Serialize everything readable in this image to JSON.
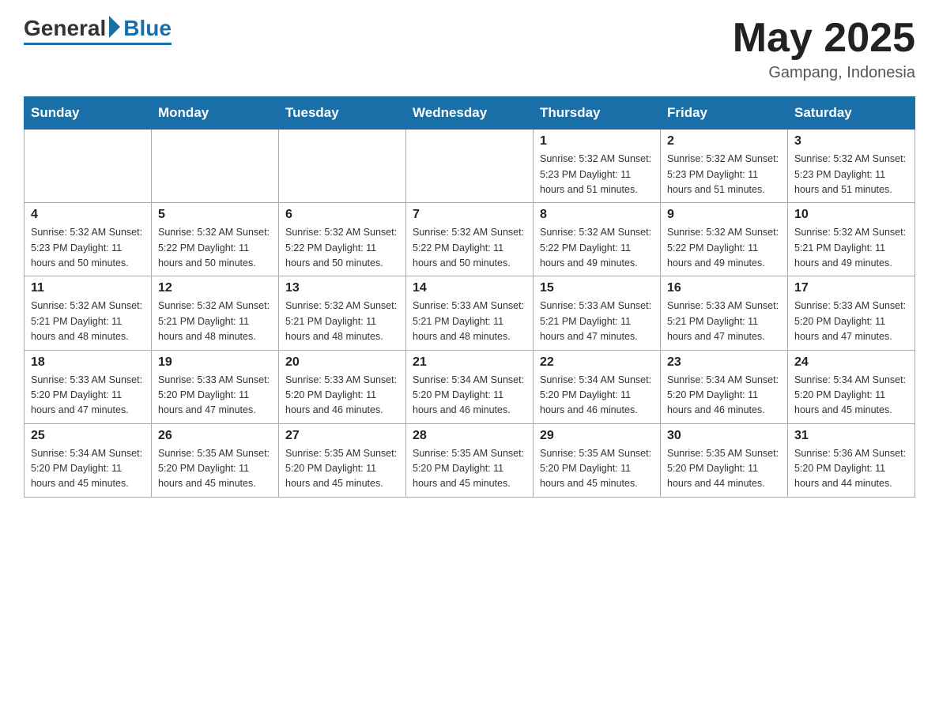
{
  "header": {
    "logo_general": "General",
    "logo_blue": "Blue",
    "month_title": "May 2025",
    "location": "Gampang, Indonesia"
  },
  "days_of_week": [
    "Sunday",
    "Monday",
    "Tuesday",
    "Wednesday",
    "Thursday",
    "Friday",
    "Saturday"
  ],
  "weeks": [
    [
      {
        "day": "",
        "info": ""
      },
      {
        "day": "",
        "info": ""
      },
      {
        "day": "",
        "info": ""
      },
      {
        "day": "",
        "info": ""
      },
      {
        "day": "1",
        "info": "Sunrise: 5:32 AM\nSunset: 5:23 PM\nDaylight: 11 hours\nand 51 minutes."
      },
      {
        "day": "2",
        "info": "Sunrise: 5:32 AM\nSunset: 5:23 PM\nDaylight: 11 hours\nand 51 minutes."
      },
      {
        "day": "3",
        "info": "Sunrise: 5:32 AM\nSunset: 5:23 PM\nDaylight: 11 hours\nand 51 minutes."
      }
    ],
    [
      {
        "day": "4",
        "info": "Sunrise: 5:32 AM\nSunset: 5:23 PM\nDaylight: 11 hours\nand 50 minutes."
      },
      {
        "day": "5",
        "info": "Sunrise: 5:32 AM\nSunset: 5:22 PM\nDaylight: 11 hours\nand 50 minutes."
      },
      {
        "day": "6",
        "info": "Sunrise: 5:32 AM\nSunset: 5:22 PM\nDaylight: 11 hours\nand 50 minutes."
      },
      {
        "day": "7",
        "info": "Sunrise: 5:32 AM\nSunset: 5:22 PM\nDaylight: 11 hours\nand 50 minutes."
      },
      {
        "day": "8",
        "info": "Sunrise: 5:32 AM\nSunset: 5:22 PM\nDaylight: 11 hours\nand 49 minutes."
      },
      {
        "day": "9",
        "info": "Sunrise: 5:32 AM\nSunset: 5:22 PM\nDaylight: 11 hours\nand 49 minutes."
      },
      {
        "day": "10",
        "info": "Sunrise: 5:32 AM\nSunset: 5:21 PM\nDaylight: 11 hours\nand 49 minutes."
      }
    ],
    [
      {
        "day": "11",
        "info": "Sunrise: 5:32 AM\nSunset: 5:21 PM\nDaylight: 11 hours\nand 48 minutes."
      },
      {
        "day": "12",
        "info": "Sunrise: 5:32 AM\nSunset: 5:21 PM\nDaylight: 11 hours\nand 48 minutes."
      },
      {
        "day": "13",
        "info": "Sunrise: 5:32 AM\nSunset: 5:21 PM\nDaylight: 11 hours\nand 48 minutes."
      },
      {
        "day": "14",
        "info": "Sunrise: 5:33 AM\nSunset: 5:21 PM\nDaylight: 11 hours\nand 48 minutes."
      },
      {
        "day": "15",
        "info": "Sunrise: 5:33 AM\nSunset: 5:21 PM\nDaylight: 11 hours\nand 47 minutes."
      },
      {
        "day": "16",
        "info": "Sunrise: 5:33 AM\nSunset: 5:21 PM\nDaylight: 11 hours\nand 47 minutes."
      },
      {
        "day": "17",
        "info": "Sunrise: 5:33 AM\nSunset: 5:20 PM\nDaylight: 11 hours\nand 47 minutes."
      }
    ],
    [
      {
        "day": "18",
        "info": "Sunrise: 5:33 AM\nSunset: 5:20 PM\nDaylight: 11 hours\nand 47 minutes."
      },
      {
        "day": "19",
        "info": "Sunrise: 5:33 AM\nSunset: 5:20 PM\nDaylight: 11 hours\nand 47 minutes."
      },
      {
        "day": "20",
        "info": "Sunrise: 5:33 AM\nSunset: 5:20 PM\nDaylight: 11 hours\nand 46 minutes."
      },
      {
        "day": "21",
        "info": "Sunrise: 5:34 AM\nSunset: 5:20 PM\nDaylight: 11 hours\nand 46 minutes."
      },
      {
        "day": "22",
        "info": "Sunrise: 5:34 AM\nSunset: 5:20 PM\nDaylight: 11 hours\nand 46 minutes."
      },
      {
        "day": "23",
        "info": "Sunrise: 5:34 AM\nSunset: 5:20 PM\nDaylight: 11 hours\nand 46 minutes."
      },
      {
        "day": "24",
        "info": "Sunrise: 5:34 AM\nSunset: 5:20 PM\nDaylight: 11 hours\nand 45 minutes."
      }
    ],
    [
      {
        "day": "25",
        "info": "Sunrise: 5:34 AM\nSunset: 5:20 PM\nDaylight: 11 hours\nand 45 minutes."
      },
      {
        "day": "26",
        "info": "Sunrise: 5:35 AM\nSunset: 5:20 PM\nDaylight: 11 hours\nand 45 minutes."
      },
      {
        "day": "27",
        "info": "Sunrise: 5:35 AM\nSunset: 5:20 PM\nDaylight: 11 hours\nand 45 minutes."
      },
      {
        "day": "28",
        "info": "Sunrise: 5:35 AM\nSunset: 5:20 PM\nDaylight: 11 hours\nand 45 minutes."
      },
      {
        "day": "29",
        "info": "Sunrise: 5:35 AM\nSunset: 5:20 PM\nDaylight: 11 hours\nand 45 minutes."
      },
      {
        "day": "30",
        "info": "Sunrise: 5:35 AM\nSunset: 5:20 PM\nDaylight: 11 hours\nand 44 minutes."
      },
      {
        "day": "31",
        "info": "Sunrise: 5:36 AM\nSunset: 5:20 PM\nDaylight: 11 hours\nand 44 minutes."
      }
    ]
  ]
}
